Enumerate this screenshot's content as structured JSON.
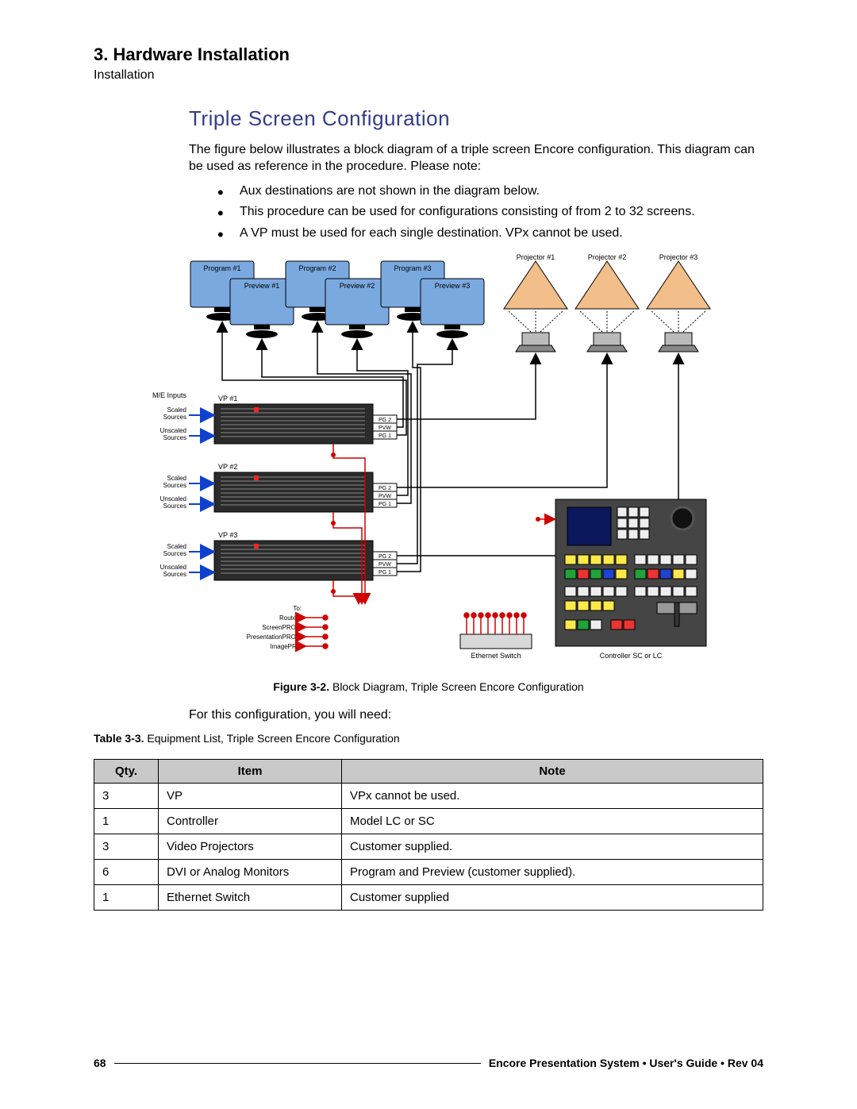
{
  "section": {
    "number_title": "3.  Hardware Installation",
    "breadcrumb": "Installation"
  },
  "subheading": "Triple Screen Configuration",
  "intro_paragraph": "The figure below illustrates a block diagram of a triple screen Encore configuration.  This diagram can be used as reference in the procedure.  Please note:",
  "bullets": [
    "Aux destinations are not shown in the diagram below.",
    "This procedure can be used for configurations consisting of from 2 to 32 screens.",
    "A VP must be used for each single destination.  VPx cannot be used."
  ],
  "figure": {
    "caption_bold": "Figure 3-2.",
    "caption_rest": "  Block Diagram, Triple Screen Encore Configuration",
    "labels": {
      "program1": "Program #1",
      "program2": "Program #2",
      "program3": "Program #3",
      "preview1": "Preview #1",
      "preview2": "Preview #2",
      "preview3": "Preview #3",
      "projector1": "Projector #1",
      "projector2": "Projector #2",
      "projector3": "Projector #3",
      "me_inputs": "M/E Inputs",
      "vp1": "VP #1",
      "vp2": "VP #2",
      "vp3": "VP #3",
      "scaled": "Scaled",
      "sources": "Sources",
      "unscaled": "Unscaled",
      "pg2": "PG 2",
      "pvw": "PVW",
      "pg1": "PG 1",
      "to": "To:",
      "routers": "Routers",
      "screenpro": "ScreenPRO-II",
      "presentationpro": "PresentationPRO-II",
      "imagepro": "ImagePRO",
      "eth_switch": "Ethernet Switch",
      "controller": "Controller SC or LC"
    }
  },
  "need_line": "For this configuration, you will need:",
  "table": {
    "caption_bold": "Table 3-3.",
    "caption_rest": "  Equipment List, Triple Screen Encore Configuration",
    "headers": {
      "qty": "Qty.",
      "item": "Item",
      "note": "Note"
    },
    "rows": [
      {
        "qty": "3",
        "item": "VP",
        "note": "VPx cannot be used."
      },
      {
        "qty": "1",
        "item": "Controller",
        "note": "Model LC or SC"
      },
      {
        "qty": "3",
        "item": "Video Projectors",
        "note": "Customer supplied."
      },
      {
        "qty": "6",
        "item": "DVI or Analog Monitors",
        "note": "Program and Preview (customer supplied)."
      },
      {
        "qty": "1",
        "item": "Ethernet Switch",
        "note": "Customer supplied"
      }
    ]
  },
  "footer": {
    "page_no": "68",
    "doc_title": "Encore Presentation System  •  User's Guide  •  Rev 04"
  }
}
